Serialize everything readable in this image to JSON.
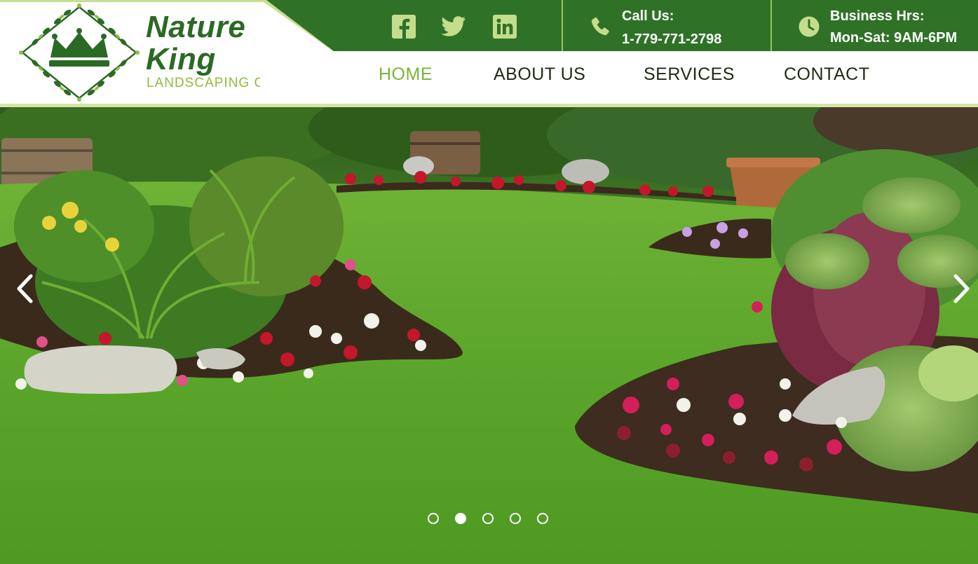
{
  "brand": {
    "name_line1": "Nature",
    "name_line2": "King",
    "tagline": "LANDSCAPING CO"
  },
  "top_bar": {
    "social": [
      {
        "name": "facebook-icon",
        "glyph": "f"
      },
      {
        "name": "twitter-icon",
        "glyph": "bird"
      },
      {
        "name": "linkedin-icon",
        "glyph": "in"
      }
    ],
    "phone": {
      "label": "Call Us:",
      "value": "1-779-771-2798",
      "icon": "phone-icon"
    },
    "hours": {
      "label": "Business Hrs:",
      "value": "Mon-Sat: 9AM-6PM",
      "icon": "clock-icon"
    }
  },
  "nav": {
    "items": [
      {
        "label": "HOME",
        "active": true
      },
      {
        "label": "ABOUT US",
        "active": false
      },
      {
        "label": "SERVICES",
        "active": false
      },
      {
        "label": "CONTACT",
        "active": false
      }
    ]
  },
  "hero": {
    "slide_count": 5,
    "active_slide": 2,
    "prev_icon": "chevron-left-icon",
    "next_icon": "chevron-right-icon"
  },
  "colors": {
    "brand_green": "#2f7227",
    "accent_green": "#7bb33a",
    "light_green": "#d3e6a6",
    "nav_text": "#1f2a14"
  }
}
